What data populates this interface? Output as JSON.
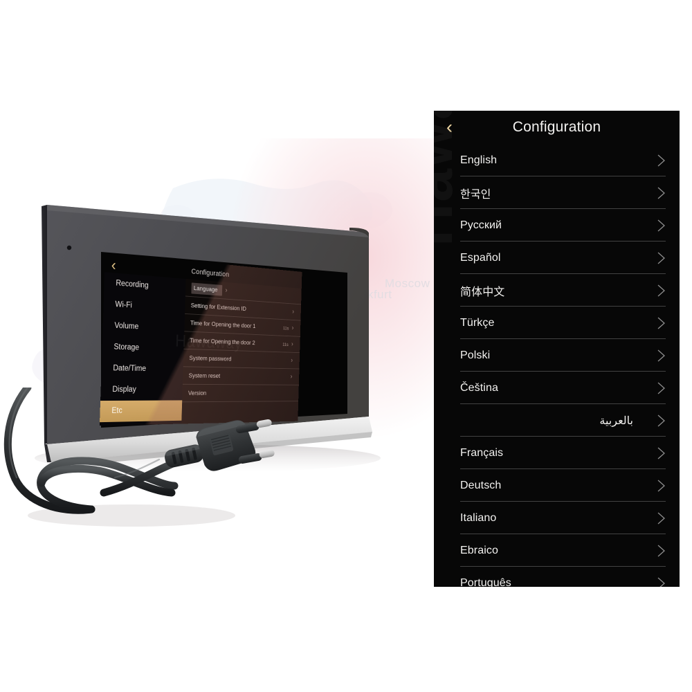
{
  "background": {
    "city_labels": [
      "Moscow",
      "Frankfurt"
    ],
    "watermark": "Hawaway",
    "page_bg": "#ffffff"
  },
  "device": {
    "type": "video-intercom-monitor",
    "screen": {
      "back_icon": "‹",
      "title": "Configuration",
      "sidebar": [
        {
          "label": "Recording",
          "active": false
        },
        {
          "label": "Wi-Fi",
          "active": false
        },
        {
          "label": "Volume",
          "active": false
        },
        {
          "label": "Storage",
          "active": false
        },
        {
          "label": "Date/Time",
          "active": false
        },
        {
          "label": "Display",
          "active": false
        },
        {
          "label": "Etc",
          "active": true
        }
      ],
      "active_color": "#c9a063",
      "rows": [
        {
          "label": "Language",
          "value": "",
          "highlighted": true
        },
        {
          "label": "Setting for Extension ID",
          "value": "",
          "highlighted": false
        },
        {
          "label": "Time for Opening the door 1",
          "value": "11s",
          "highlighted": false
        },
        {
          "label": "Time for Opening the door 2",
          "value": "11s",
          "highlighted": false
        },
        {
          "label": "System  password",
          "value": "",
          "highlighted": false
        },
        {
          "label": "System reset",
          "value": "",
          "highlighted": false
        },
        {
          "label": "Version",
          "value": "",
          "highlighted": false
        }
      ],
      "chevron": "›",
      "watermark": "Hawaway"
    }
  },
  "panel": {
    "back_icon": "‹",
    "title": "Configuration",
    "watermark": "Hawaway",
    "accent_color": "#f0d8a4",
    "bg_color": "#070707",
    "languages": [
      {
        "label": "English",
        "rtl": false
      },
      {
        "label": "한국인",
        "rtl": false
      },
      {
        "label": "Русский",
        "rtl": false
      },
      {
        "label": "Español",
        "rtl": false
      },
      {
        "label": "简体中文",
        "rtl": false
      },
      {
        "label": "Türkçe",
        "rtl": false
      },
      {
        "label": "Polski",
        "rtl": false
      },
      {
        "label": "Čeština",
        "rtl": false
      },
      {
        "label": "بالعربية",
        "rtl": true
      },
      {
        "label": "Français",
        "rtl": false
      },
      {
        "label": "Deutsch",
        "rtl": false
      },
      {
        "label": "Italiano",
        "rtl": false
      },
      {
        "label": "Ebraico",
        "rtl": false
      },
      {
        "label": "Português",
        "rtl": false
      }
    ]
  }
}
